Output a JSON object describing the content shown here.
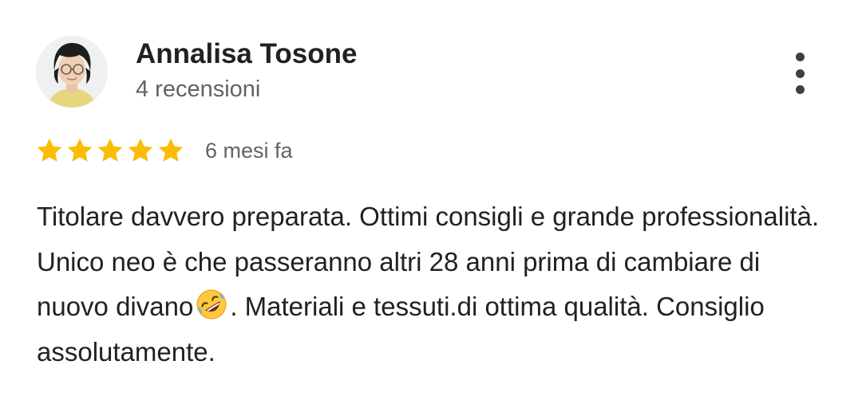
{
  "review": {
    "author_name": "Annalisa Tosone",
    "review_count": "4 recensioni",
    "rating": 5,
    "rating_max": 5,
    "time": "6 mesi fa",
    "text_part1": "Titolare davvero preparata. Ottimi consigli e grande professionalità. Unico neo è che passeranno altri 28 anni prima di cambiare di nuovo divano",
    "emoji": "rolling-on-the-floor-laughing-emoji",
    "text_part2": ". Materiali e tessuti.di ottima qualità. Consiglio assolutamente."
  },
  "icons": {
    "more": "more-vert-icon",
    "star": "star-icon"
  },
  "colors": {
    "star": "#fbbc04",
    "name": "#202124",
    "secondary": "#5f6368",
    "menu_dots": "#3c4043"
  }
}
